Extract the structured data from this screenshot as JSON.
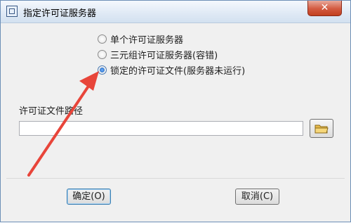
{
  "window": {
    "title": "指定许可证服务器",
    "close_glyph": "✕"
  },
  "options": [
    {
      "label": "单个许可证服务器",
      "selected": false
    },
    {
      "label": "三元组许可证服务器(容错)",
      "selected": false
    },
    {
      "label": "锁定的许可证文件(服务器未运行)",
      "selected": true
    }
  ],
  "path_field": {
    "label": "许可证文件路径",
    "value": "",
    "browse_icon": "folder-icon"
  },
  "buttons": {
    "ok": "确定(O)",
    "cancel": "取消(C)"
  },
  "annotation": {
    "arrow_color": "#e8453a"
  }
}
